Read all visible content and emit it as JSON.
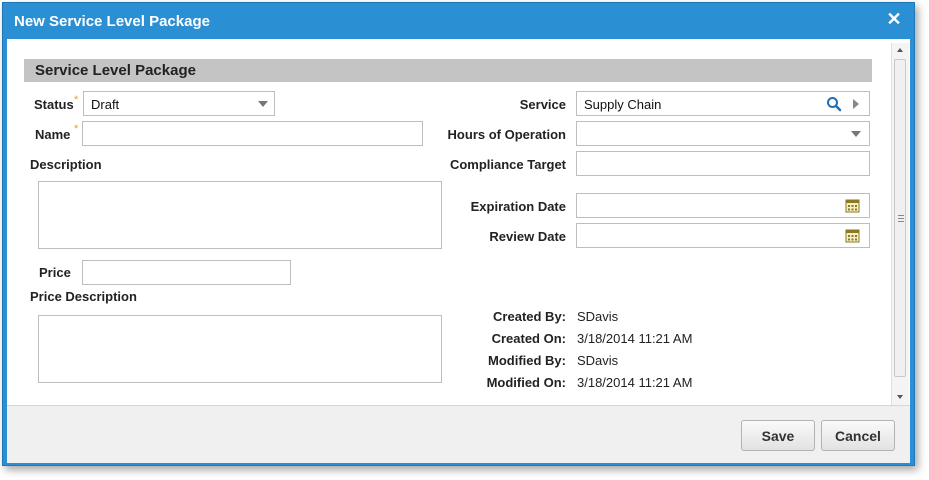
{
  "dialog": {
    "title": "New Service Level Package",
    "close_glyph": "✕"
  },
  "section": {
    "title": "Service Level Package"
  },
  "form": {
    "status": {
      "label": "Status",
      "required_mark": "*",
      "value": "Draft"
    },
    "name": {
      "label": "Name",
      "required_mark": "*",
      "value": ""
    },
    "description": {
      "label": "Description",
      "value": ""
    },
    "price": {
      "label": "Price",
      "value": ""
    },
    "price_description": {
      "label": "Price Description",
      "value": ""
    },
    "service": {
      "label": "Service",
      "value": "Supply Chain"
    },
    "hours_of_operation": {
      "label": "Hours of Operation",
      "value": ""
    },
    "compliance_target": {
      "label": "Compliance Target",
      "value": ""
    },
    "expiration_date": {
      "label": "Expiration Date",
      "value": ""
    },
    "review_date": {
      "label": "Review Date",
      "value": ""
    }
  },
  "audit": {
    "created_by": {
      "label": "Created By:",
      "value": "SDavis"
    },
    "created_on": {
      "label": "Created On:",
      "value": "3/18/2014 11:21 AM"
    },
    "modified_by": {
      "label": "Modified By:",
      "value": "SDavis"
    },
    "modified_on": {
      "label": "Modified On:",
      "value": "3/18/2014 11:21 AM"
    }
  },
  "buttons": {
    "save": "Save",
    "cancel": "Cancel"
  },
  "icons": {
    "search": "search-icon",
    "calendar": "calendar-icon",
    "dropdown": "chevron-down-icon"
  },
  "colors": {
    "title_bar": "#2b8fd3",
    "section_header": "#c4c4c4",
    "required": "#f29a25",
    "search_icon": "#1f6fb5",
    "calendar_icon": "#8a7a22"
  }
}
